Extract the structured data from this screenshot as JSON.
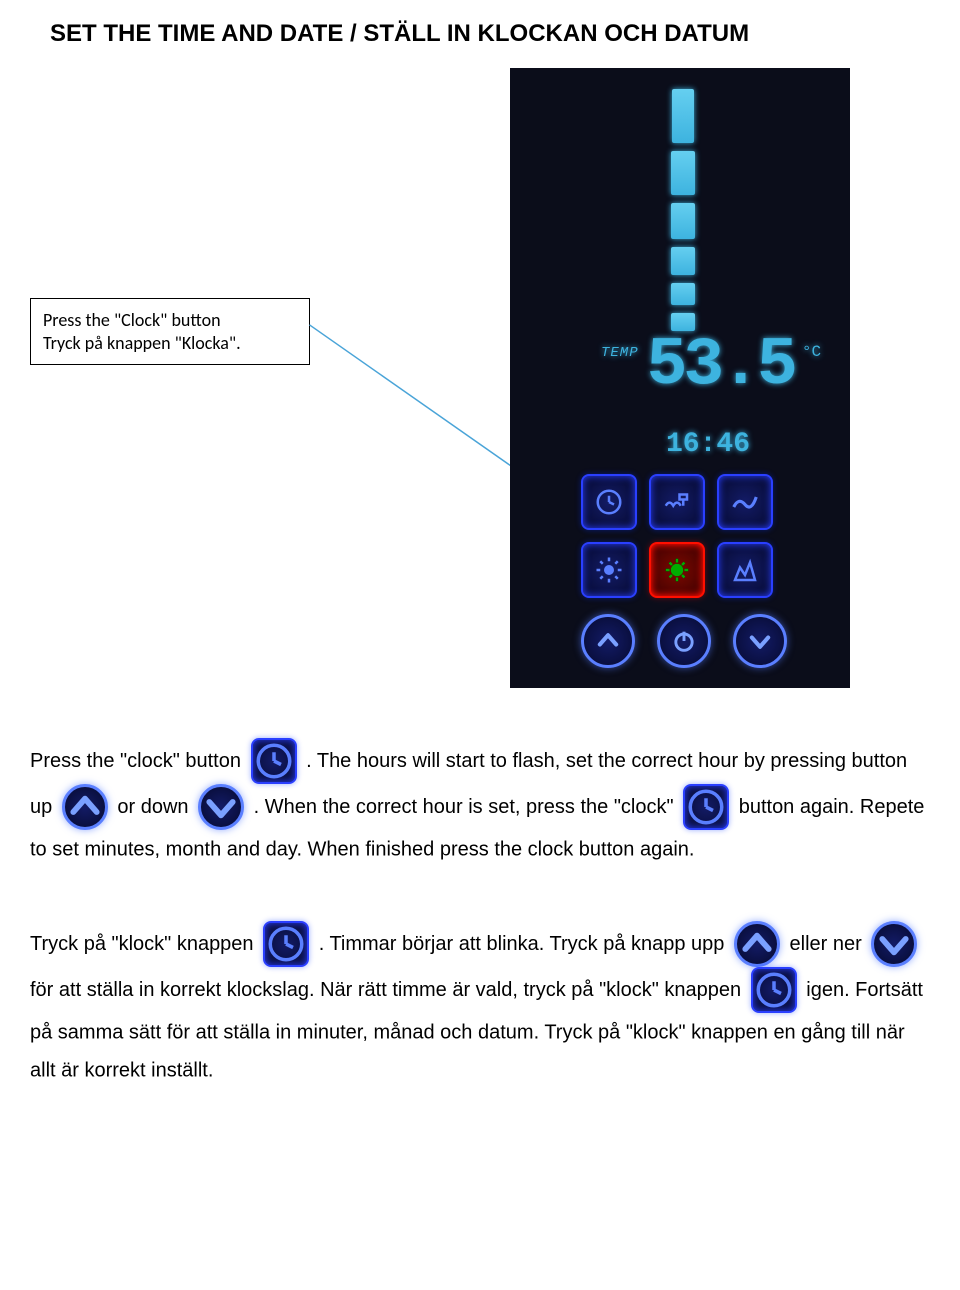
{
  "title": "SET THE TIME AND DATE / STÄLL IN KLOCKAN OCH DATUM",
  "callout": {
    "line1": "Press the \"Clock\" button",
    "line2": "Tryck på knappen \"Klocka\"."
  },
  "panel": {
    "temp_label": "TEMP",
    "temp_value": "53.5",
    "temp_unit": "°C",
    "time_value": "16:46"
  },
  "para_en": {
    "t1": "Press the \"clock\" button ",
    "t2": ". The hours will start to flash, set the correct hour by pressing button up ",
    "t3": " or down ",
    "t4": ". When the correct hour is set, press the \"clock\" ",
    "t5": " button again. Repete to set minutes, month and day. When finished press the clock button again."
  },
  "para_sv": {
    "t1": "Tryck på \"klock\" knappen ",
    "t2": ". Timmar börjar att blinka. Tryck på knapp upp ",
    "t3": " eller ner ",
    "t4": " för att ställa in korrekt klockslag. När rätt timme är vald, tryck på \"klock\" knappen ",
    "t5": " igen. Fortsätt på samma sätt för att ställa in minuter, månad och datum. Tryck på \"klock\" knappen en gång till när allt är korrekt inställt."
  }
}
